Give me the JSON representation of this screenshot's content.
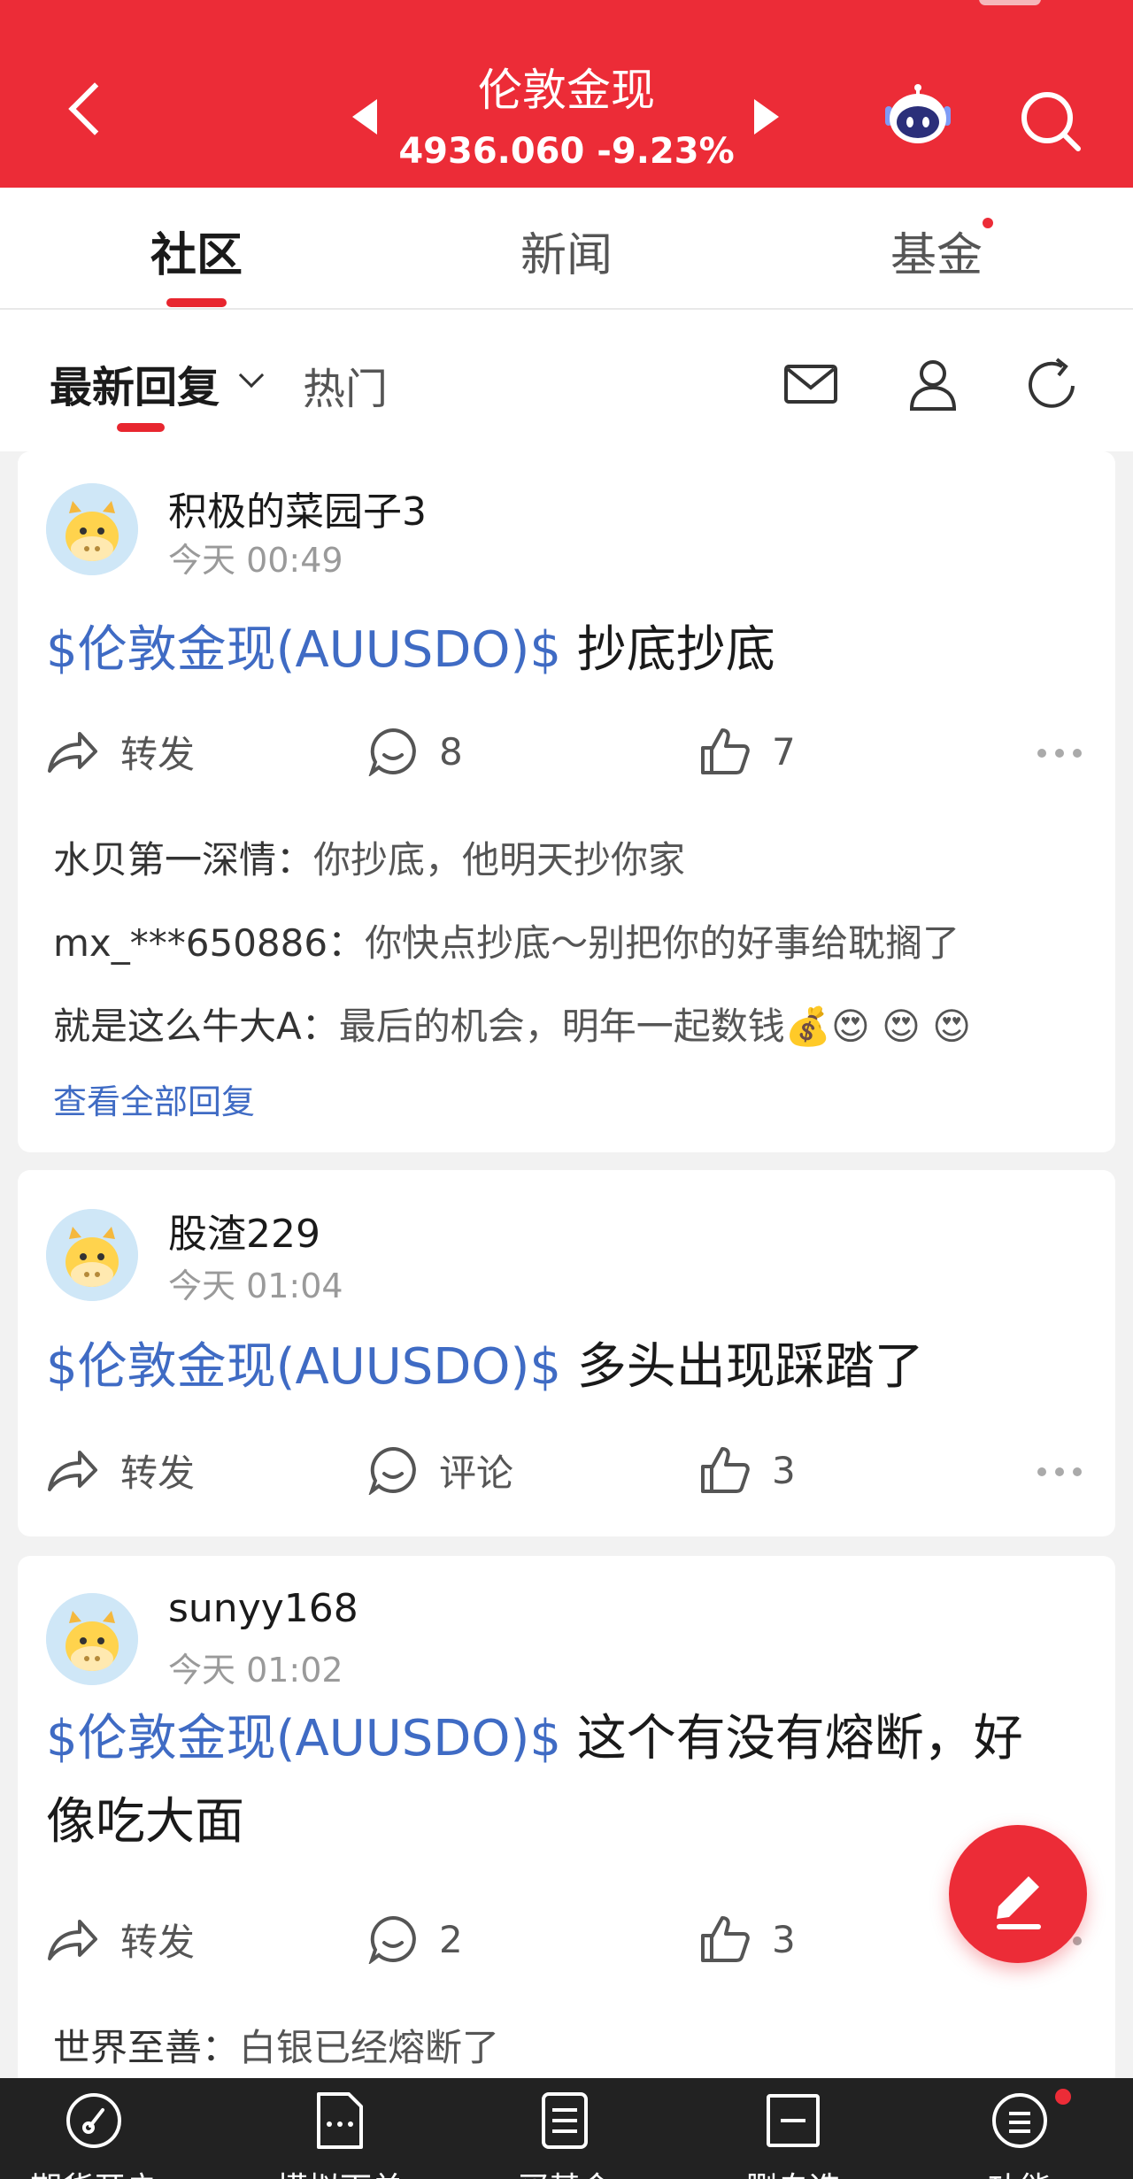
{
  "header": {
    "title": "伦敦金现",
    "quote": "4936.060 -9.23%"
  },
  "tabs": [
    {
      "label": "社区",
      "active": true
    },
    {
      "label": "新闻",
      "active": false
    },
    {
      "label": "基金",
      "active": false,
      "has_dot": true
    }
  ],
  "subbar": {
    "latest_label": "最新回复",
    "hot_label": "热门"
  },
  "posts": [
    {
      "user": "积极的菜园子3",
      "time": "今天 00:49",
      "tag": "$伦敦金现(AUUSDO)$",
      "text_line1": " 抄底抄底",
      "text_line2": "",
      "forward_label": "转发",
      "comment_count": "8",
      "like_count": "7",
      "replies": [
        {
          "who": "水贝第一深情：",
          "msg": "你抄底，他明天抄你家"
        },
        {
          "who": "mx_***650886：",
          "msg": "你快点抄底～别把你的好事给耽搁了"
        },
        {
          "who": "就是这么牛大A：",
          "msg": "最后的机会，明年一起数钱💰😍 😍 😍"
        }
      ],
      "view_all": "查看全部回复"
    },
    {
      "user": "股渣229",
      "time": "今天 01:04",
      "tag": "$伦敦金现(AUUSDO)$",
      "text_line1": " 多头出现踩踏了",
      "text_line2": "",
      "forward_label": "转发",
      "comment_count": "评论",
      "like_count": "3"
    },
    {
      "user": "sunyy168",
      "time": "今天 01:02",
      "tag": "$伦敦金现(AUUSDO)$",
      "text_line1": " 这个有没有熔断，好",
      "text_line2": "像吃大面",
      "forward_label": "转发",
      "comment_count": "2",
      "like_count": "3",
      "replies": [
        {
          "who": "世界至善：",
          "msg": "白银已经熔断了"
        }
      ]
    }
  ],
  "bottom_nav": [
    {
      "label": "期货开户",
      "icon": "speedometer-icon"
    },
    {
      "label": "模拟下单",
      "icon": "document-dots-icon"
    },
    {
      "label": "买基金",
      "icon": "document-lines-icon"
    },
    {
      "label": "删自选",
      "icon": "minus-square-icon"
    },
    {
      "label": "功能",
      "icon": "menu-circle-icon"
    }
  ],
  "colors": {
    "brand_red": "#ec2c37",
    "link_blue": "#3f6bc4",
    "bottom_bar": "#222222"
  }
}
